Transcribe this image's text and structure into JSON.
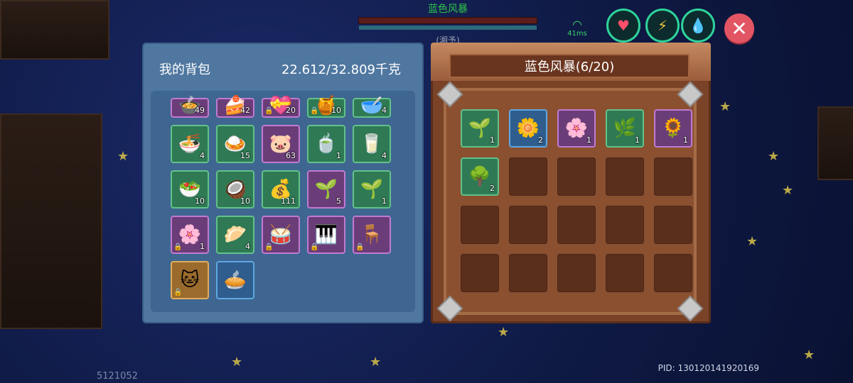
{
  "top_target": {
    "name": "蓝色风暴",
    "subtitle": "(湘予)"
  },
  "hud": {
    "ping": "41ms",
    "icons": [
      "heart-icon",
      "stamina-icon",
      "water-icon"
    ],
    "close_label": "✕"
  },
  "backpack": {
    "title": "我的背包",
    "weight": "22.612/32.809千克",
    "items": [
      {
        "icon": "🍲",
        "count": "49",
        "quality": "purple",
        "partial": true
      },
      {
        "icon": "🍰",
        "count": "42",
        "quality": "purple",
        "partial": true
      },
      {
        "icon": "💝",
        "count": "20",
        "quality": "purple",
        "partial": true,
        "locked": true
      },
      {
        "icon": "🍯",
        "count": "10",
        "quality": "green",
        "partial": true,
        "locked": true
      },
      {
        "icon": "🥣",
        "count": "4",
        "quality": "green",
        "partial": true
      },
      {
        "icon": "🍜",
        "count": "4",
        "quality": "green"
      },
      {
        "icon": "🍛",
        "count": "15",
        "quality": "green"
      },
      {
        "icon": "🐷",
        "count": "63",
        "quality": "purple"
      },
      {
        "icon": "🍵",
        "count": "1",
        "quality": "green"
      },
      {
        "icon": "🥛",
        "count": "4",
        "quality": "green"
      },
      {
        "icon": "🥗",
        "count": "10",
        "quality": "green"
      },
      {
        "icon": "🥥",
        "count": "10",
        "quality": "green"
      },
      {
        "icon": "💰",
        "count": "111",
        "quality": "green"
      },
      {
        "icon": "🌱",
        "count": "5",
        "quality": "purple"
      },
      {
        "icon": "🌱",
        "count": "1",
        "quality": "green"
      },
      {
        "icon": "🌸",
        "count": "1",
        "quality": "purple",
        "locked": true
      },
      {
        "icon": "🥟",
        "count": "4",
        "quality": "green"
      },
      {
        "icon": "🥁",
        "count": "",
        "quality": "purple",
        "locked": true
      },
      {
        "icon": "🎹",
        "count": "",
        "quality": "purple",
        "locked": true
      },
      {
        "icon": "🪑",
        "count": "",
        "quality": "purple",
        "locked": true
      },
      {
        "icon": "🐱",
        "count": "",
        "quality": "orange",
        "locked": true
      },
      {
        "icon": "🥧",
        "count": "",
        "quality": "blue"
      }
    ]
  },
  "storage": {
    "title": "蓝色风暴(6/20)",
    "items": [
      {
        "icon": "🌱",
        "count": "1",
        "quality": "green"
      },
      {
        "icon": "🌼",
        "count": "2",
        "quality": "blue"
      },
      {
        "icon": "🌸",
        "count": "1",
        "quality": "purple"
      },
      {
        "icon": "🌿",
        "count": "1",
        "quality": "green"
      },
      {
        "icon": "🌻",
        "count": "1",
        "quality": "purple"
      },
      {
        "icon": "🌳",
        "count": "2",
        "quality": "green"
      }
    ],
    "capacity": 20
  },
  "footer": {
    "pid": "PID: 130120141920169",
    "left_id": "5121052"
  },
  "colors": {
    "bag_bg": "#4f77a0",
    "storage_bg": "#7a4328",
    "close_btn": "#e25563"
  }
}
